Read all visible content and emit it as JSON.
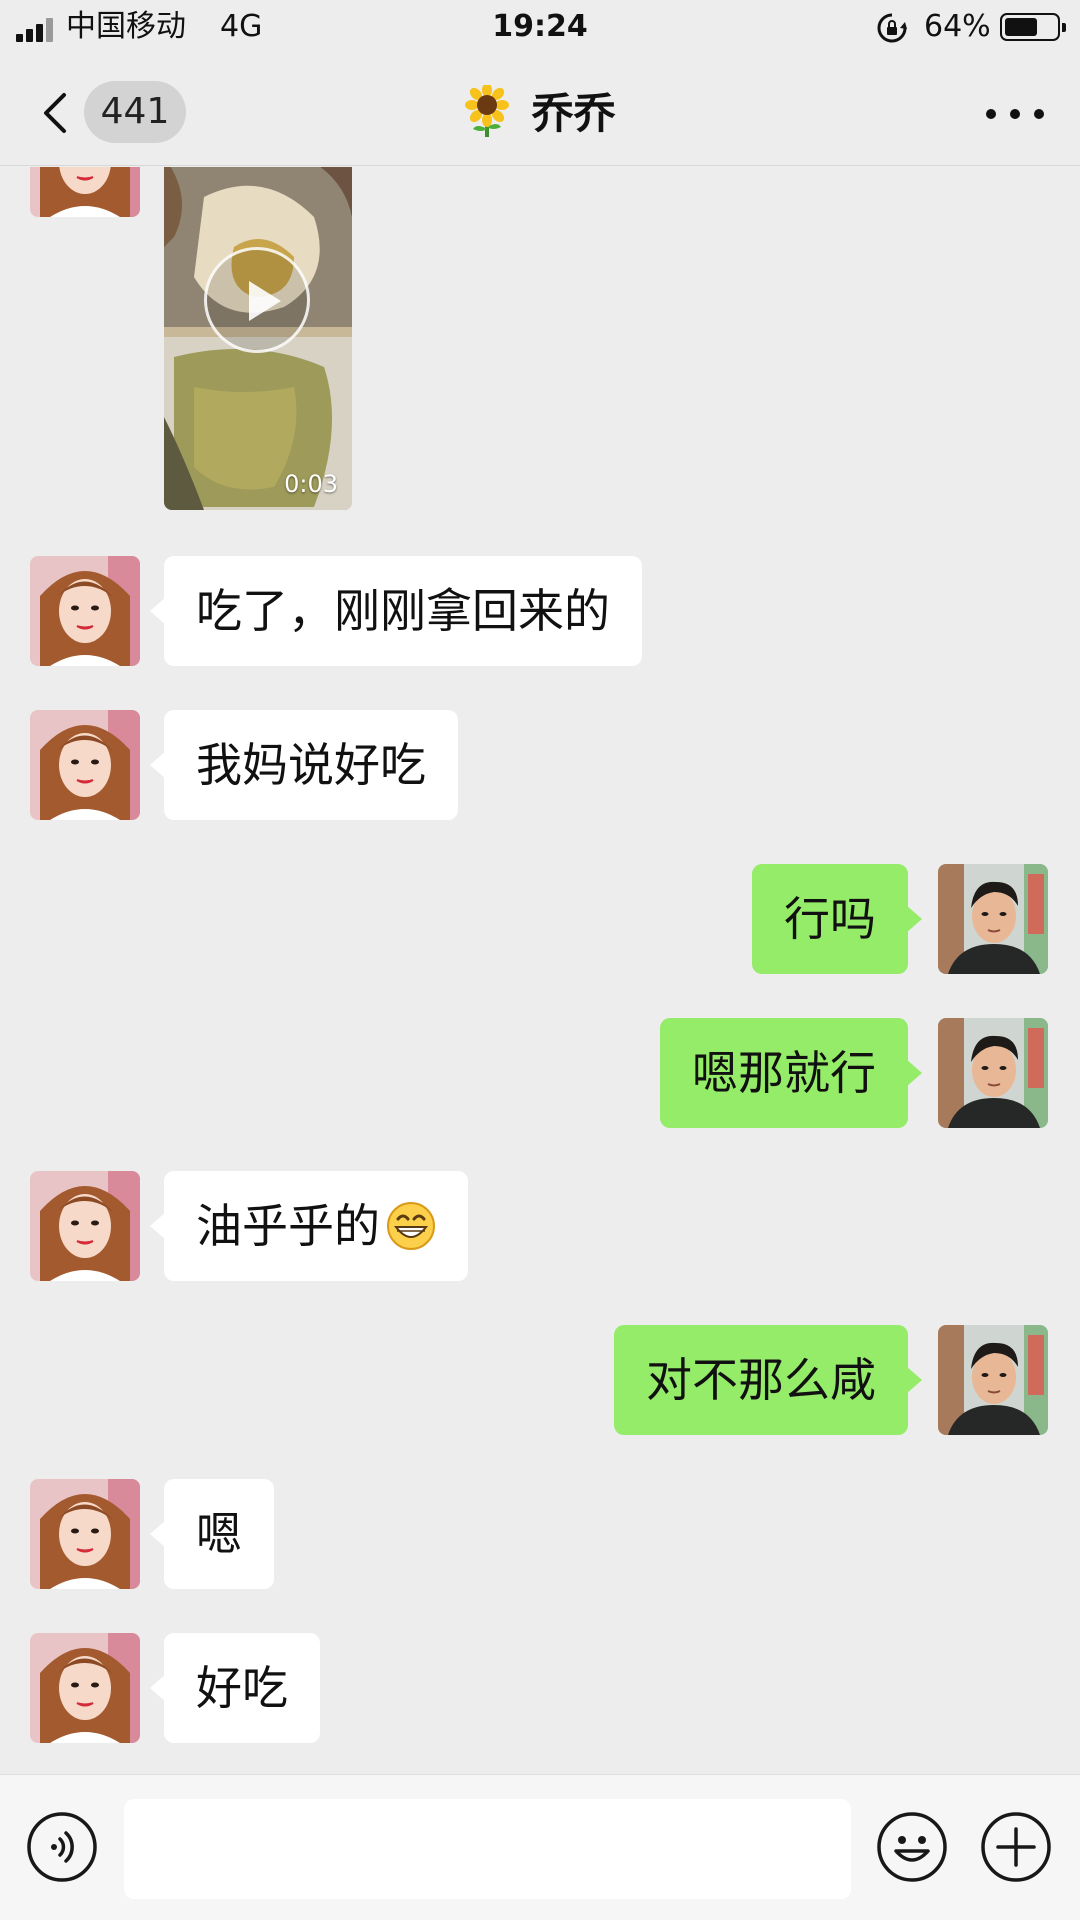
{
  "status_bar": {
    "carrier": "中国移动",
    "network": "4G",
    "time": "19:24",
    "battery": "64%",
    "battery_level": 0.64,
    "signal_bars": 3,
    "icons": [
      "signal-icon",
      "rotation-lock-icon",
      "battery-icon"
    ]
  },
  "nav": {
    "back_icon": "chevron-left-icon",
    "unread_count": "441",
    "title_emoji": "sunflower",
    "title": "乔乔",
    "more_icon": "ellipsis-icon"
  },
  "chat": {
    "video": {
      "duration": "0:03",
      "icon": "play-icon"
    },
    "messages": [
      {
        "from": "contact",
        "text": "吃了，刚刚拿回来的"
      },
      {
        "from": "contact",
        "text": "我妈说好吃"
      },
      {
        "from": "me",
        "text": "行吗"
      },
      {
        "from": "me",
        "text": "嗯那就行"
      },
      {
        "from": "contact",
        "text": "油乎乎的",
        "emoji": "grinning-face"
      },
      {
        "from": "me",
        "text": "对不那么咸"
      },
      {
        "from": "contact",
        "text": "嗯"
      },
      {
        "from": "contact",
        "text": "好吃"
      }
    ]
  },
  "input_bar": {
    "value": "",
    "placeholder": "",
    "icons": [
      "voice-icon",
      "emoji-icon",
      "plus-icon"
    ]
  },
  "colors": {
    "background": "#ededed",
    "outgoing_bubble": "#95ec69",
    "incoming_bubble": "#ffffff"
  }
}
